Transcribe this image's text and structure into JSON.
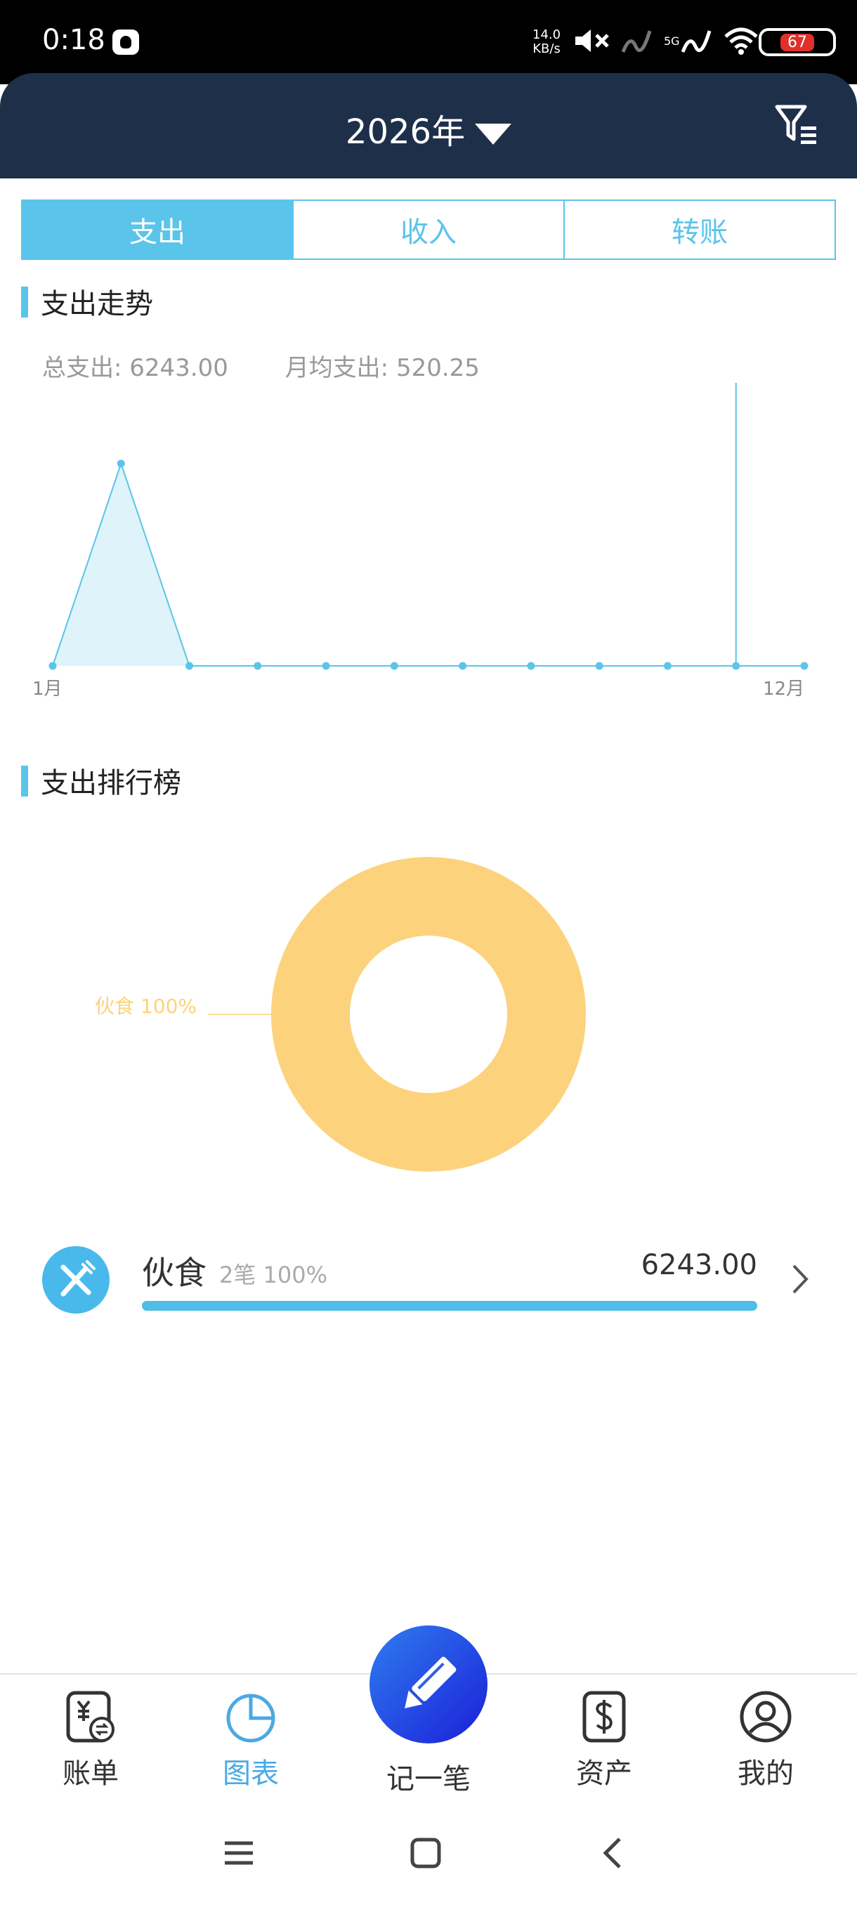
{
  "status_bar": {
    "time": "0:18",
    "net_speed_value": "14.0",
    "net_speed_unit": "KB/s",
    "network": "5G",
    "battery": "67"
  },
  "header": {
    "year": "2026年"
  },
  "tabs": [
    {
      "label": "支出",
      "active": true
    },
    {
      "label": "收入",
      "active": false
    },
    {
      "label": "转账",
      "active": false
    }
  ],
  "trend": {
    "title": "支出走势",
    "total_label": "总支出: 6243.00",
    "avg_label": "月均支出: 520.25",
    "first_month_label": "1月",
    "last_month_label": "12月"
  },
  "chart_data": [
    {
      "type": "area",
      "x": [
        "1月",
        "2月",
        "3月",
        "4月",
        "5月",
        "6月",
        "7月",
        "8月",
        "9月",
        "10月",
        "11月",
        "12月"
      ],
      "series": [
        {
          "values": [
            0,
            6243,
            0,
            0,
            0,
            0,
            0,
            0,
            0,
            0,
            0,
            0
          ]
        }
      ],
      "tick_labels": [
        "1月",
        "12月"
      ],
      "color": "#5bc4ea",
      "fill": "#dff3fa"
    },
    {
      "type": "pie",
      "categories": [
        "伙食"
      ],
      "values": [
        100
      ],
      "slice_labels": [
        "伙食 100%"
      ],
      "color": "#fdd27c"
    }
  ],
  "ranking": {
    "title": "支出排行榜",
    "items": [
      {
        "name": "伙食",
        "meta": "2笔 100%",
        "amount": "6243.00",
        "share": 1.0,
        "icon": "utensils-icon",
        "icon_color": "#49b9ec"
      }
    ]
  },
  "bottom_nav": {
    "items": [
      {
        "label": "账单",
        "icon": "bill-icon",
        "active": false
      },
      {
        "label": "图表",
        "icon": "chart-icon",
        "active": true
      },
      {
        "label": "记一笔",
        "icon": "pencil-icon",
        "active": false
      },
      {
        "label": "资产",
        "icon": "assets-icon",
        "active": false
      },
      {
        "label": "我的",
        "icon": "profile-icon",
        "active": false
      }
    ]
  },
  "colors": {
    "accent": "#5bc4ea",
    "header_bg": "#1e2f4a",
    "active_nav": "#4aa9e4",
    "donut": "#fdd27c"
  }
}
